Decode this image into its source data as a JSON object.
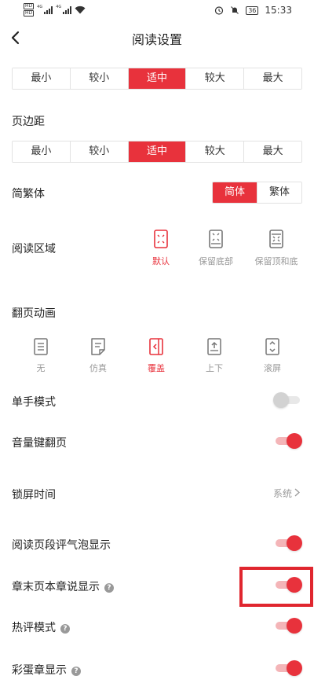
{
  "status_bar": {
    "hd1": "HD",
    "hd2": "HD",
    "net1": "4G",
    "net2": "4G",
    "battery": "36",
    "time": "15:33"
  },
  "header": {
    "title": "阅读设置",
    "back_icon": "chevron-left-icon"
  },
  "font_size": {
    "options": [
      "最小",
      "较小",
      "适中",
      "较大",
      "最大"
    ],
    "selected": "适中"
  },
  "margin": {
    "label": "页边距",
    "options": [
      "最小",
      "较小",
      "适中",
      "较大",
      "最大"
    ],
    "selected": "适中"
  },
  "script": {
    "label": "简繁体",
    "options": [
      "简体",
      "繁体"
    ],
    "selected": "简体"
  },
  "reading_area": {
    "label": "阅读区域",
    "options": [
      "默认",
      "保留底部",
      "保留顶和底"
    ],
    "selected": "默认"
  },
  "page_turn": {
    "label": "翻页动画",
    "options": [
      "无",
      "仿真",
      "覆盖",
      "上下",
      "滚屏"
    ],
    "selected": "覆盖"
  },
  "settings": {
    "one_hand": {
      "label": "单手模式",
      "on": false
    },
    "volume_turn": {
      "label": "音量键翻页",
      "on": true
    },
    "lock_time": {
      "label": "锁屏时间",
      "value": "系统"
    },
    "paragraph_bubble": {
      "label": "阅读页段评气泡显示",
      "on": true
    },
    "chapter_comment": {
      "label": "章末页本章说显示",
      "on": true
    },
    "hot_comment": {
      "label": "热评模式",
      "on": true
    },
    "easter_egg": {
      "label": "彩蛋章显示",
      "on": true
    }
  },
  "colors": {
    "accent": "#e8323c",
    "highlight_box": "#e0262f"
  }
}
